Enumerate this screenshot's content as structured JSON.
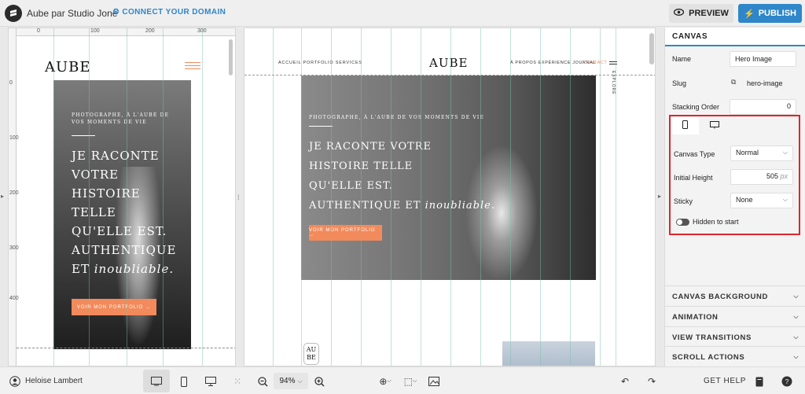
{
  "topbar": {
    "site_title": "Aube par Studio Jone",
    "connect_domain": "CONNECT YOUR DOMAIN",
    "preview_label": "PREVIEW",
    "publish_label": "PUBLISH"
  },
  "rulers": {
    "h_labels": [
      "0",
      "100",
      "200",
      "300"
    ],
    "v_labels": [
      "0",
      "100",
      "200",
      "300",
      "400"
    ]
  },
  "mobile": {
    "brand": "AUBE",
    "subtitle": "PHOTOGRAPHE, À L'AUBE DE VOS MOMENTS DE VIE",
    "headline_lines": [
      "JE RACONTE",
      "VOTRE",
      "HISTOIRE",
      "TELLE",
      "QU'ELLE EST.",
      "AUTHENTIQUE",
      "ET"
    ],
    "headline_script": "inoubliable.",
    "cta": "VOIR MON PORTFOLIO →"
  },
  "desktop": {
    "nav_left": "ACCUEIL  PORTFOLIO  SERVICES",
    "brand": "AUBE",
    "nav_right": "À PROPOS  EXPÉRIENCE  JOURNAL",
    "nav_contact": "CONTACT",
    "explore": "EXPLORE",
    "subtitle": "PHOTOGRAPHE, À L'AUBE DE VOS MOMENTS DE VIE",
    "headline_lines": [
      "JE RACONTE VOTRE",
      "HISTOIRE TELLE",
      "QU'ELLE EST.",
      "AUTHENTIQUE ET"
    ],
    "headline_script": "inoubliable.",
    "cta": "VOIR MON PORTFOLIO →",
    "badge_top": "AU",
    "badge_bottom": "BE"
  },
  "panel": {
    "header": "CANVAS",
    "name_label": "Name",
    "name_value": "Hero Image",
    "slug_label": "Slug",
    "slug_value": "hero-image",
    "stacking_label": "Stacking Order",
    "stacking_value": "0",
    "canvas_type_label": "Canvas Type",
    "canvas_type_value": "Normal",
    "initial_height_label": "Initial Height",
    "initial_height_value": "505",
    "initial_height_unit": "px",
    "sticky_label": "Sticky",
    "sticky_value": "None",
    "hidden_label": "Hidden to start",
    "sections": [
      "CANVAS BACKGROUND",
      "ANIMATION",
      "VIEW TRANSITIONS",
      "SCROLL ACTIONS"
    ],
    "highlight_color": "#e0252b"
  },
  "bottombar": {
    "user_name": "Heloise Lambert",
    "zoom": "94%",
    "help": "GET HELP"
  }
}
